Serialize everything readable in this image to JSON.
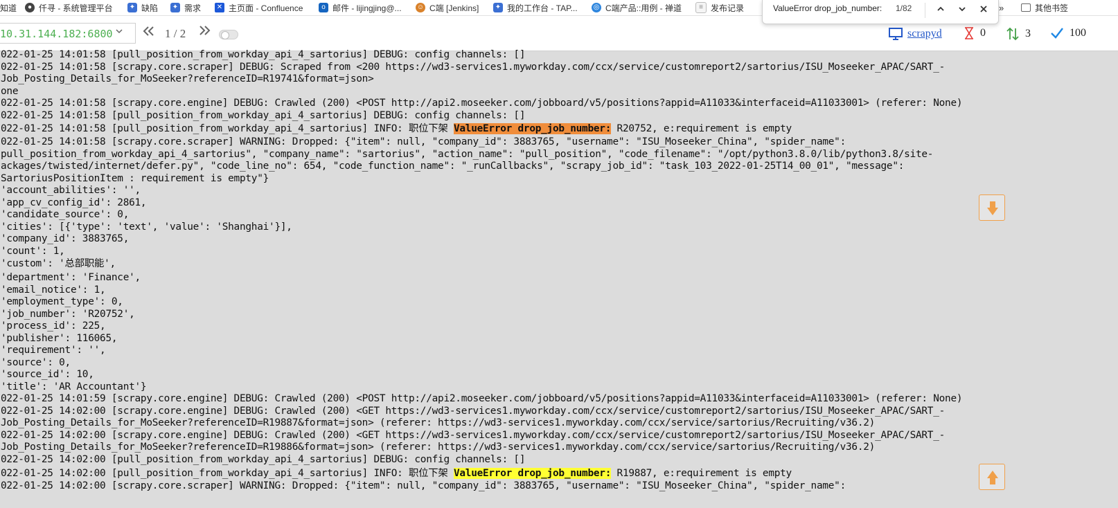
{
  "bookmarks": [
    {
      "label": "知道",
      "icon": "none"
    },
    {
      "label": "仟寻 - 系统管理平台",
      "icon": "github-icon"
    },
    {
      "label": "缺陷",
      "icon": "tapd-icon"
    },
    {
      "label": "需求",
      "icon": "tapd-icon"
    },
    {
      "label": "主页面 - Confluence",
      "icon": "confluence-icon"
    },
    {
      "label": "邮件 - lijingjing@...",
      "icon": "outlook-icon"
    },
    {
      "label": "C端 [Jenkins]",
      "icon": "jenkins-icon"
    },
    {
      "label": "我的工作台 - TAP...",
      "icon": "tapd-icon"
    },
    {
      "label": "C端产品::用例 - 禅道",
      "icon": "globe-icon"
    },
    {
      "label": "发布记录",
      "icon": "doc-icon"
    },
    {
      "label": "其他书签",
      "icon": "folder-icon"
    }
  ],
  "find": {
    "query": "ValueError drop_job_number:",
    "count": "1/82"
  },
  "toolbar": {
    "host": "10.31.144.182:6800",
    "page": "1 / 2",
    "node_label": "scrapyd",
    "pending": "0",
    "running": "3",
    "finished": "100"
  },
  "log": {
    "lines": [
      {
        "pre": "022-01-25 14:01:58 [pull_position_from_workday_api_4_sartorius] DEBUG: config channels: []"
      },
      {
        "pre": "022-01-25 14:01:58 [scrapy.core.scraper] DEBUG: Scraped from <200 https://wd3-services1.myworkday.com/ccx/service/customreport2/sartorius/ISU_Moseeker_APAC/SART_-"
      },
      {
        "pre": "Job_Posting_Details_for_MoSeeker?referenceID=R19741&format=json>"
      },
      {
        "pre": "one"
      },
      {
        "pre": "022-01-25 14:01:58 [scrapy.core.engine] DEBUG: Crawled (200) <POST http://api2.moseeker.com/jobboard/v5/positions?appid=A11033&interfaceid=A11033001> (referer: None)"
      },
      {
        "pre": "022-01-25 14:01:58 [pull_position_from_workday_api_4_sartorius] DEBUG: config channels: []"
      },
      {
        "pre": "022-01-25 14:01:58 [pull_position_from_workday_api_4_sartorius] INFO: 职位下架 ",
        "hl": "ValueError drop_job_number:",
        "hlc": "orange",
        "post": " R20752, e:requirement is empty"
      },
      {
        "pre": "022-01-25 14:01:58 [scrapy.core.scraper] WARNING: Dropped: {\"item\": null, \"company_id\": 3883765, \"username\": \"ISU_Moseeker_China\", \"spider_name\":"
      },
      {
        "pre": "pull_position_from_workday_api_4_sartorius\", \"company_name\": \"sartorius\", \"action_name\": \"pull_position\", \"code_filename\": \"/opt/python3.8.0/lib/python3.8/site-"
      },
      {
        "pre": "ackages/twisted/internet/defer.py\", \"code_line_no\": 654, \"code_function_name\": \"_runCallbacks\", \"scrapy_job_id\": \"task_103_2022-01-25T14_00_01\", \"message\":"
      },
      {
        "pre": "SartoriusPositionItem : requirement is empty\"}"
      },
      {
        "pre": "'account_abilities': '',"
      },
      {
        "pre": "'app_cv_config_id': 2861,"
      },
      {
        "pre": "'candidate_source': 0,"
      },
      {
        "pre": "'cities': [{'type': 'text', 'value': 'Shanghai'}],"
      },
      {
        "pre": "'company_id': 3883765,"
      },
      {
        "pre": "'count': 1,"
      },
      {
        "pre": "'custom': '总部职能',"
      },
      {
        "pre": "'department': 'Finance',"
      },
      {
        "pre": "'email_notice': 1,"
      },
      {
        "pre": "'employment_type': 0,"
      },
      {
        "pre": "'job_number': 'R20752',"
      },
      {
        "pre": "'process_id': 225,"
      },
      {
        "pre": "'publisher': 116065,"
      },
      {
        "pre": "'requirement': '',"
      },
      {
        "pre": "'source': 0,"
      },
      {
        "pre": "'source_id': 10,"
      },
      {
        "pre": "'title': 'AR Accountant'}"
      },
      {
        "pre": "022-01-25 14:01:59 [scrapy.core.engine] DEBUG: Crawled (200) <POST http://api2.moseeker.com/jobboard/v5/positions?appid=A11033&interfaceid=A11033001> (referer: None)"
      },
      {
        "pre": "022-01-25 14:02:00 [scrapy.core.engine] DEBUG: Crawled (200) <GET https://wd3-services1.myworkday.com/ccx/service/customreport2/sartorius/ISU_Moseeker_APAC/SART_-"
      },
      {
        "pre": "Job_Posting_Details_for_MoSeeker?referenceID=R19887&format=json> (referer: https://wd3-services1.myworkday.com/ccx/service/sartorius/Recruiting/v36.2)"
      },
      {
        "pre": "022-01-25 14:02:00 [scrapy.core.engine] DEBUG: Crawled (200) <GET https://wd3-services1.myworkday.com/ccx/service/customreport2/sartorius/ISU_Moseeker_APAC/SART_-"
      },
      {
        "pre": "Job_Posting_Details_for_MoSeeker?referenceID=R19886&format=json> (referer: https://wd3-services1.myworkday.com/ccx/service/sartorius/Recruiting/v36.2)"
      },
      {
        "pre": "022-01-25 14:02:00 [pull_position_from_workday_api_4_sartorius] DEBUG: config channels: []"
      },
      {
        "pre": "022-01-25 14:02:00 [pull_position_from_workday_api_4_sartorius] INFO: 职位下架 ",
        "hl": "ValueError drop_job_number:",
        "hlc": "yellow",
        "post": " R19887, e:requirement is empty"
      },
      {
        "pre": "022-01-25 14:02:00 [scrapy.core.scraper] WARNING: Dropped: {\"item\": null, \"company_id\": 3883765, \"username\": \"ISU_Moseeker_China\", \"spider_name\":"
      }
    ]
  },
  "colors": {
    "host_text": "#4caf50",
    "highlight_current": "#f08d3b",
    "highlight_match": "#ffff33",
    "link": "#2458c8",
    "pending_icon": "#e53935",
    "running_icon": "#43a047",
    "finished_icon": "#1e88e5",
    "fab_border": "#f0a04a"
  }
}
